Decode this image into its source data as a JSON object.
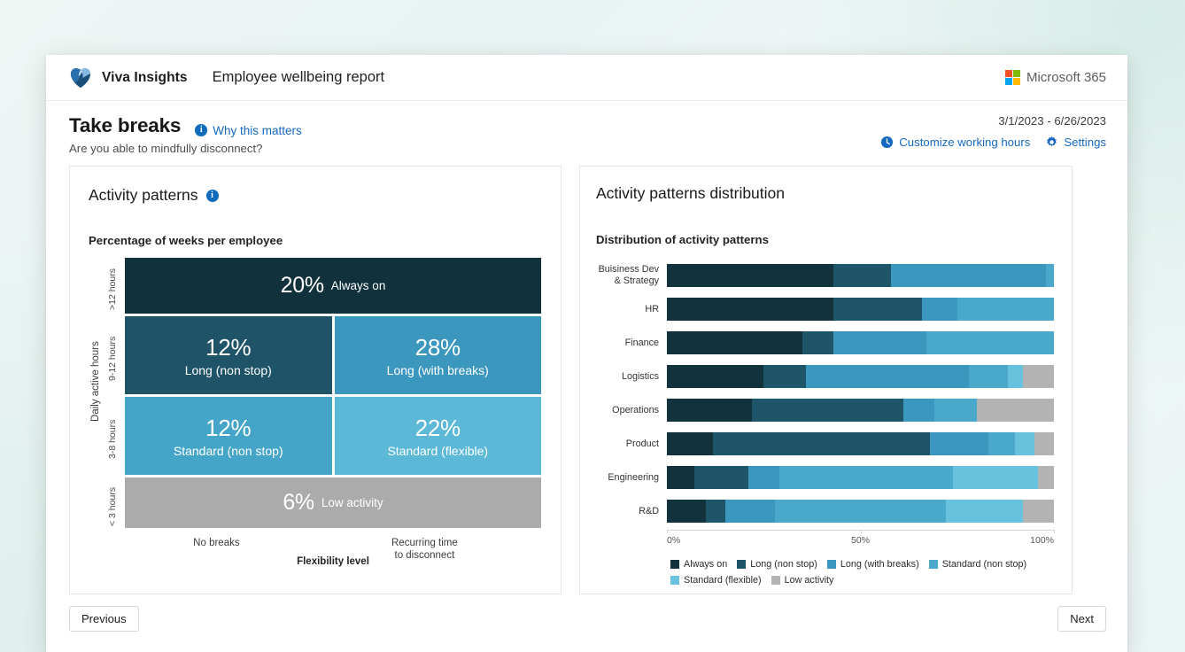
{
  "topbar": {
    "brand": "Viva Insights",
    "report_title": "Employee wellbeing report",
    "ms_label": "Microsoft 365",
    "viva_icon": "viva-insights-logo",
    "ms_icon": "microsoft-logo"
  },
  "page": {
    "title": "Take breaks",
    "why_link": "Why this matters",
    "subtitle": "Are you able to mindfully disconnect?",
    "date_range": "3/1/2023 - 6/26/2023",
    "customize_working_hours": "Customize working hours",
    "settings": "Settings"
  },
  "left_card": {
    "title": "Activity patterns",
    "section_label": "Percentage of weeks per employee",
    "y_axis_title": "Daily active hours",
    "y_ticks": [
      ">12 hours",
      "9-12 hours",
      "3-8 hours",
      "< 3 hours"
    ],
    "x_left": "No breaks",
    "x_right_line1": "Recurring time",
    "x_right_line2": "to disconnect",
    "x_axis_title": "Flexibility level",
    "cells": {
      "always_on": {
        "pct": "20%",
        "name": "Always on",
        "color": "#11323d"
      },
      "long_non_stop": {
        "pct": "12%",
        "name": "Long (non stop)",
        "color": "#1f5468"
      },
      "long_with_breaks": {
        "pct": "28%",
        "name": "Long (with breaks)",
        "color": "#3c97bf"
      },
      "standard_non_stop": {
        "pct": "12%",
        "name": "Standard (non stop)",
        "color": "#45a5c8"
      },
      "standard_flexible": {
        "pct": "22%",
        "name": "Standard (flexible)",
        "color": "#5bb8d6"
      },
      "low_activity": {
        "pct": "6%",
        "name": "Low activity",
        "color": "#ababab"
      }
    }
  },
  "right_card": {
    "title": "Activity patterns distribution",
    "section_label": "Distribution of activity patterns"
  },
  "footer": {
    "previous": "Previous",
    "next": "Next"
  },
  "chart_data": {
    "type": "bar",
    "title": "Distribution of activity patterns",
    "orientation": "horizontal",
    "stacked": true,
    "normalized": true,
    "xlabel": "",
    "ylabel": "",
    "xlim": [
      0,
      100
    ],
    "x_ticks": [
      "0%",
      "50%",
      "100%"
    ],
    "x_tick_values": [
      0,
      50,
      100
    ],
    "grid": false,
    "legend_position": "bottom",
    "categories": [
      "Buisiness Dev & Strategy",
      "HR",
      "Finance",
      "Logistics",
      "Operations",
      "Product",
      "Engineering",
      "R&D"
    ],
    "series": [
      {
        "name": "Always on",
        "color": "#12333e",
        "values": [
          43,
          43,
          35,
          25,
          22,
          12,
          7,
          10
        ]
      },
      {
        "name": "Long (non stop)",
        "color": "#1f5569",
        "values": [
          15,
          23,
          8,
          11,
          39,
          56,
          14,
          5
        ]
      },
      {
        "name": "Long (with breaks)",
        "color": "#3c97bf",
        "values": [
          40,
          9,
          24,
          42,
          8,
          15,
          8,
          13
        ]
      },
      {
        "name": "Standard (non stop)",
        "color": "#4aa8ca",
        "values": [
          2,
          25,
          33,
          10,
          11,
          7,
          45,
          44
        ]
      },
      {
        "name": "Standard (flexible)",
        "color": "#68c1dd",
        "values": [
          0,
          0,
          0,
          4,
          0,
          5,
          22,
          20
        ]
      },
      {
        "name": "Low activity",
        "color": "#b3b3b3",
        "values": [
          0,
          0,
          0,
          8,
          20,
          5,
          4,
          8
        ]
      }
    ]
  }
}
